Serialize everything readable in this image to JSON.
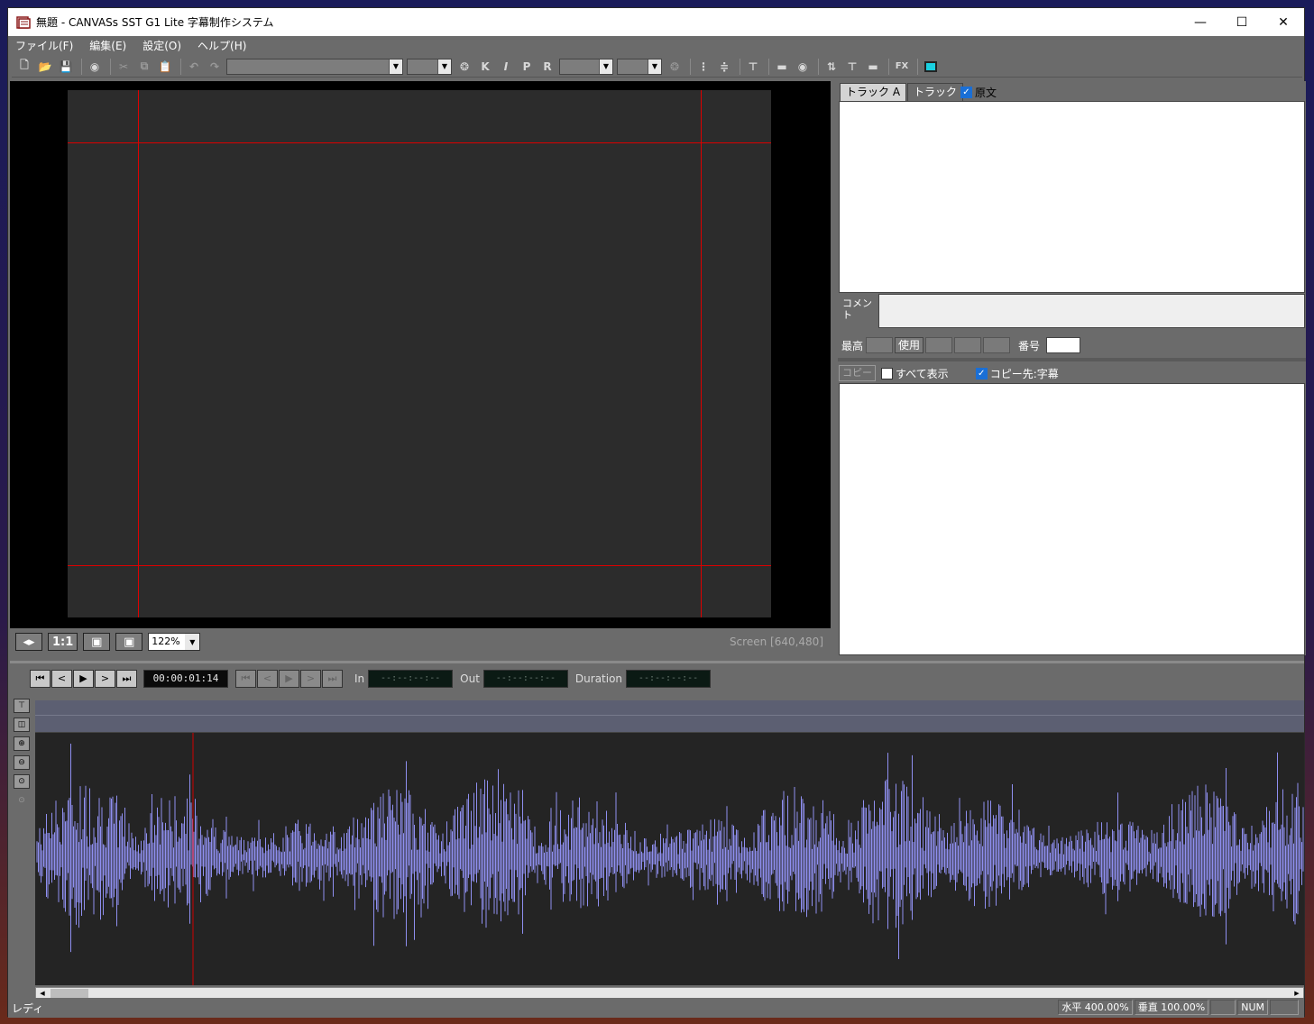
{
  "window": {
    "title": "無題 - CANVASs SST G1 Lite 字幕制作システム"
  },
  "menu": [
    "ファイル(F)",
    "編集(E)",
    "設定(O)",
    "ヘルプ(H)"
  ],
  "toolbar": {
    "bold_k": "K",
    "italic_i": "I",
    "p_label": "P",
    "r_label": "R",
    "fx_label": "FX"
  },
  "preview": {
    "btn_fit": "◂▸",
    "btn_1to1": "1:1",
    "zoom": "122%",
    "screen_info": "Screen [640,480]"
  },
  "right_panel": {
    "tab_a": "トラック A",
    "tab_b": "トラック",
    "original_label": "原文",
    "comment_label": "コメント",
    "max_label": "最高",
    "use_label": "使用",
    "number_label": "番号",
    "copy_button": "コピー",
    "show_all_label": "すべて表示",
    "copy_dest_label": "コピー先:字幕"
  },
  "transport": {
    "current_time": "00:00:01:14",
    "in_label": "In",
    "in_time": "--:--:--:--",
    "out_label": "Out",
    "out_time": "--:--:--:--",
    "duration_label": "Duration",
    "duration_time": "--:--:--:--"
  },
  "waveform": {
    "color": "#8f8ff0",
    "cursor_color": "#d00000"
  },
  "status": {
    "ready": "レディ",
    "horizontal": "水平 400.00%",
    "vertical": "垂直 100.00%",
    "num": "NUM"
  }
}
